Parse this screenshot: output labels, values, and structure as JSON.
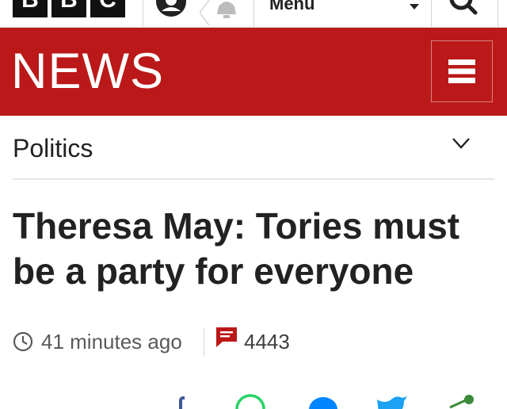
{
  "header": {
    "logo_text": [
      "B",
      "B",
      "C"
    ],
    "menu_label": "Menu"
  },
  "banner": {
    "title": "NEWS",
    "background": "#bb1919"
  },
  "section": {
    "label": "Politics"
  },
  "article": {
    "headline": "Theresa May: Tories must be a party for everyone",
    "timestamp": "41 minutes ago",
    "comment_count": "4443"
  },
  "share": {
    "icons": [
      "facebook-icon",
      "whatsapp-icon",
      "messenger-icon",
      "twitter-icon",
      "share-icon"
    ]
  },
  "colors": {
    "brand_red": "#bb1919",
    "text": "#222222",
    "meta_text": "#5a5a5a"
  }
}
